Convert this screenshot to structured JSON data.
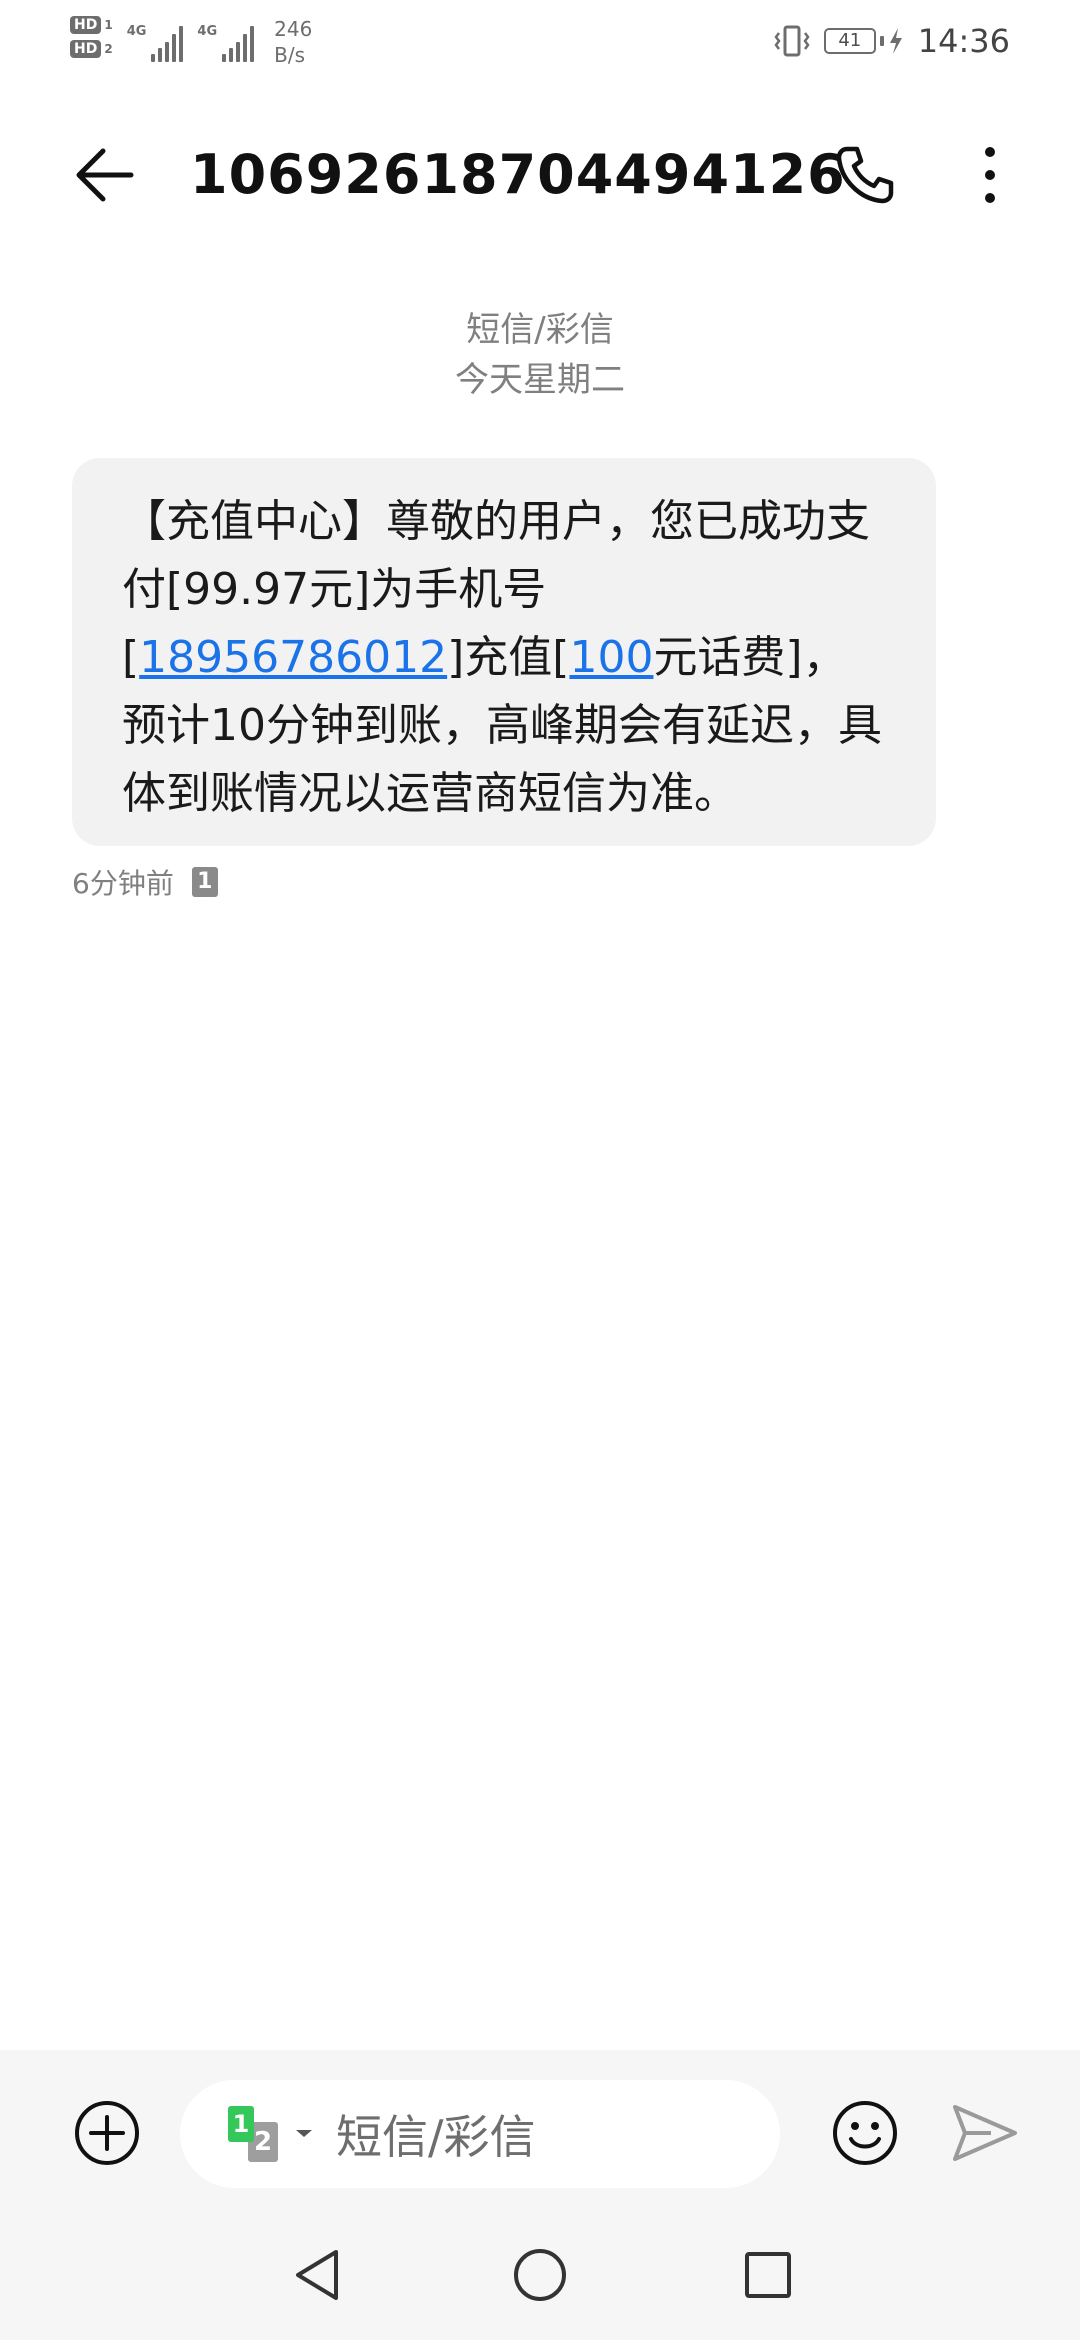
{
  "status_bar": {
    "hd1": "HD",
    "hd1_num": "1",
    "hd2": "HD",
    "hd2_num": "2",
    "net1": "4G",
    "net2": "4G",
    "speed_value": "246",
    "speed_unit": "B/s",
    "battery": "41",
    "time": "14:36"
  },
  "header": {
    "title": "10692618704494126",
    "back_icon": "arrow-left-icon",
    "call_icon": "phone-icon",
    "more_icon": "more-vertical-icon"
  },
  "meta": {
    "channel": "短信/彩信",
    "day": "今天星期二"
  },
  "message": {
    "part1": "【充值中心】尊敬的用户，您已成功支付[99.97元]为手机号[",
    "phone_link": "18956786012",
    "part2": "]充值[",
    "amount_link": "100",
    "part3": "元话费]，预计10分钟到账，高峰期会有延迟，具体到账情况以运营商短信为准。",
    "time_ago": "6分钟前",
    "sim": "1"
  },
  "input": {
    "placeholder": "短信/彩信",
    "sim1": "1",
    "sim2": "2"
  },
  "colors": {
    "link": "#1a73e8",
    "bubble": "#f2f2f2",
    "sim1": "#34c759"
  }
}
